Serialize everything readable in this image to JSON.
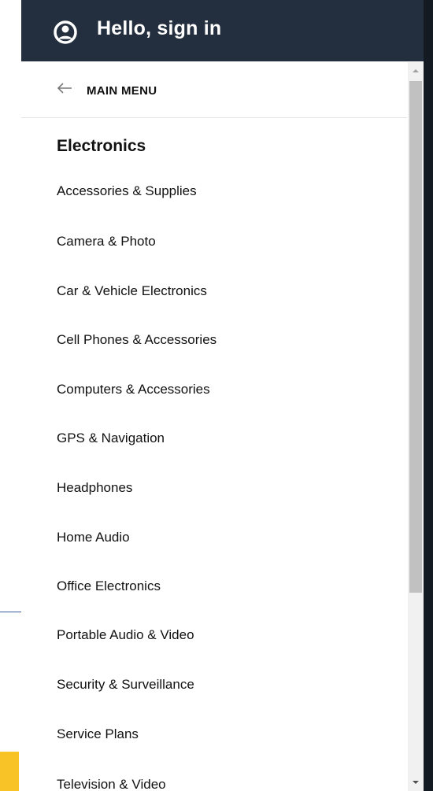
{
  "header": {
    "title": "Hello, sign in",
    "icon": "user-avatar-icon"
  },
  "nav": {
    "back_label": "MAIN MENU",
    "back_icon": "arrow-left-icon"
  },
  "section": {
    "title": "Electronics",
    "items": [
      {
        "label": "Accessories & Supplies"
      },
      {
        "label": "Camera & Photo"
      },
      {
        "label": "Car & Vehicle Electronics"
      },
      {
        "label": "Cell Phones & Accessories"
      },
      {
        "label": "Computers & Accessories"
      },
      {
        "label": "GPS & Navigation"
      },
      {
        "label": "Headphones"
      },
      {
        "label": "Home Audio"
      },
      {
        "label": "Office Electronics"
      },
      {
        "label": "Portable Audio & Video"
      },
      {
        "label": "Security & Surveillance"
      },
      {
        "label": "Service Plans"
      },
      {
        "label": "Television & Video"
      }
    ]
  },
  "colors": {
    "header_bg": "#232f3e",
    "accent_yellow": "#f7c326"
  }
}
